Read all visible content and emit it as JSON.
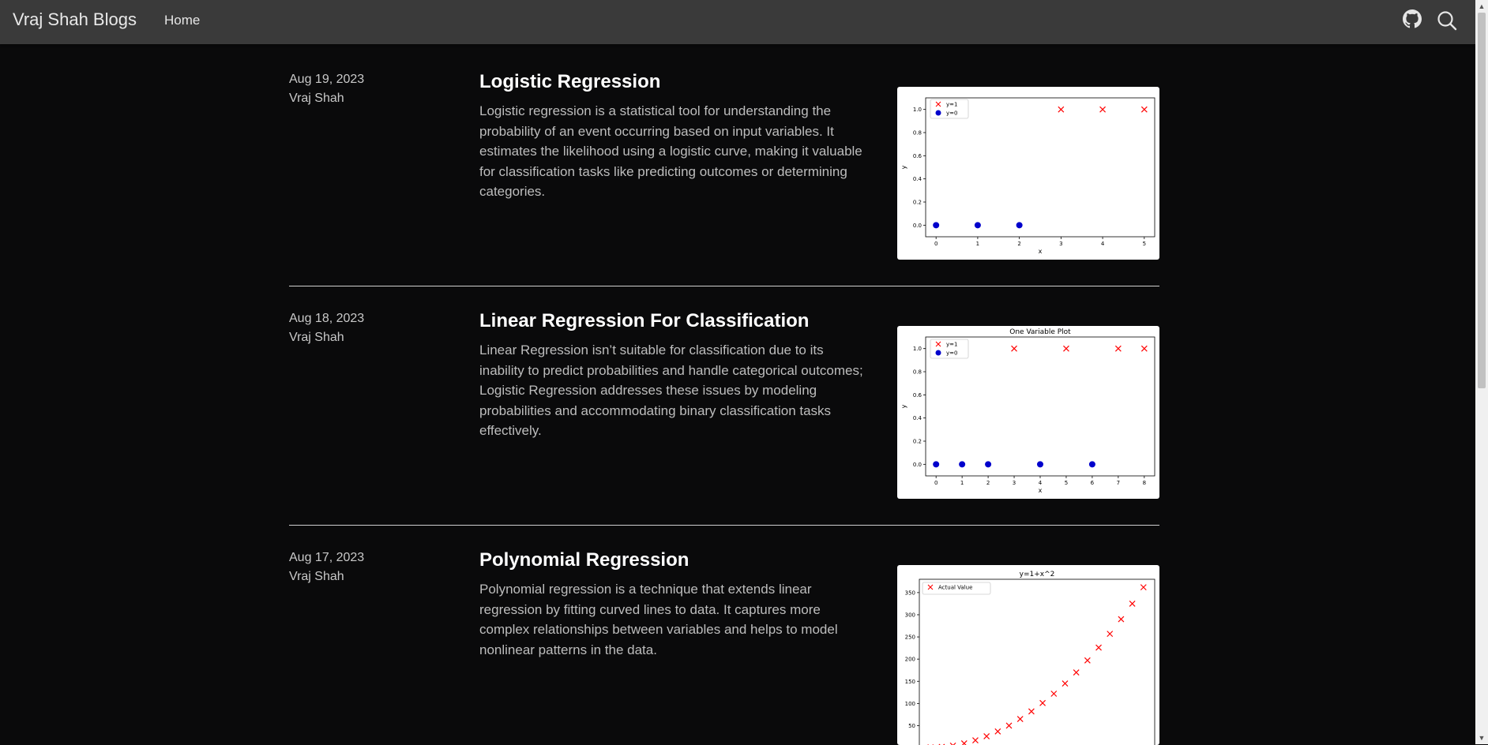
{
  "header": {
    "brand": "Vraj Shah Blogs",
    "nav_home": "Home",
    "icons": [
      "github-icon",
      "search-icon"
    ]
  },
  "posts": [
    {
      "date": "Aug 19, 2023",
      "author": "Vraj Shah",
      "title": "Logistic Regression",
      "excerpt": "Logistic regression is a statistical tool for understanding the probability of an event occurring based on input variables. It estimates the likelihood using a logistic curve, making it valuable for classification tasks like predicting outcomes or determining categories."
    },
    {
      "date": "Aug 18, 2023",
      "author": "Vraj Shah",
      "title": "Linear Regression For Classification",
      "excerpt": "Linear Regression isn’t suitable for classification due to its inability to predict probabilities and handle categorical outcomes; Logistic Regression addresses these issues by modeling probabilities and accommodating binary classification tasks effectively."
    },
    {
      "date": "Aug 17, 2023",
      "author": "Vraj Shah",
      "title": "Polynomial Regression",
      "excerpt": "Polynomial regression is a technique that extends linear regression by fitting curved lines to data. It captures more complex relationships between variables and helps to model nonlinear patterns in the data."
    }
  ],
  "chart_data": [
    {
      "type": "scatter",
      "title": "",
      "xlabel": "x",
      "ylabel": "y",
      "xlim": [
        -0.25,
        5.25
      ],
      "ylim": [
        -0.1,
        1.1
      ],
      "xticks": [
        0,
        1,
        2,
        3,
        4,
        5
      ],
      "yticks": [
        0.0,
        0.2,
        0.4,
        0.6,
        0.8,
        1.0
      ],
      "legend": "top-left",
      "series": [
        {
          "name": "y=1",
          "marker": "x",
          "color": "#ff0000",
          "x": [
            3,
            4,
            5
          ],
          "y": [
            1,
            1,
            1
          ]
        },
        {
          "name": "y=0",
          "marker": "o",
          "color": "#0000cc",
          "x": [
            0,
            1,
            2
          ],
          "y": [
            0,
            0,
            0
          ]
        }
      ]
    },
    {
      "type": "scatter",
      "title": "One Variable Plot",
      "xlabel": "x",
      "ylabel": "y",
      "xlim": [
        -0.4,
        8.4
      ],
      "ylim": [
        -0.1,
        1.1
      ],
      "xticks": [
        0,
        1,
        2,
        3,
        4,
        5,
        6,
        7,
        8
      ],
      "yticks": [
        0.0,
        0.2,
        0.4,
        0.6,
        0.8,
        1.0
      ],
      "legend": "top-left",
      "series": [
        {
          "name": "y=1",
          "marker": "x",
          "color": "#ff0000",
          "x": [
            3,
            5,
            7,
            8
          ],
          "y": [
            1,
            1,
            1,
            1
          ]
        },
        {
          "name": "y=0",
          "marker": "o",
          "color": "#0000cc",
          "x": [
            0,
            1,
            2,
            4,
            6
          ],
          "y": [
            0,
            0,
            0,
            0,
            0
          ]
        }
      ]
    },
    {
      "type": "scatter",
      "title": "y=1+x^2",
      "xlabel": "",
      "ylabel": "",
      "xlim": [
        -1,
        20
      ],
      "ylim": [
        -15,
        380
      ],
      "yticks": [
        50,
        100,
        150,
        200,
        250,
        300,
        350
      ],
      "legend": "top-left",
      "series": [
        {
          "name": "Actual Value",
          "marker": "x",
          "color": "#ff0000",
          "x": [
            0,
            1,
            2,
            3,
            4,
            5,
            6,
            7,
            8,
            9,
            10,
            11,
            12,
            13,
            14,
            15,
            16,
            17,
            18,
            19
          ],
          "y": [
            1,
            2,
            5,
            10,
            17,
            26,
            37,
            50,
            65,
            82,
            101,
            122,
            145,
            170,
            197,
            226,
            257,
            290,
            325,
            362
          ]
        }
      ]
    }
  ]
}
